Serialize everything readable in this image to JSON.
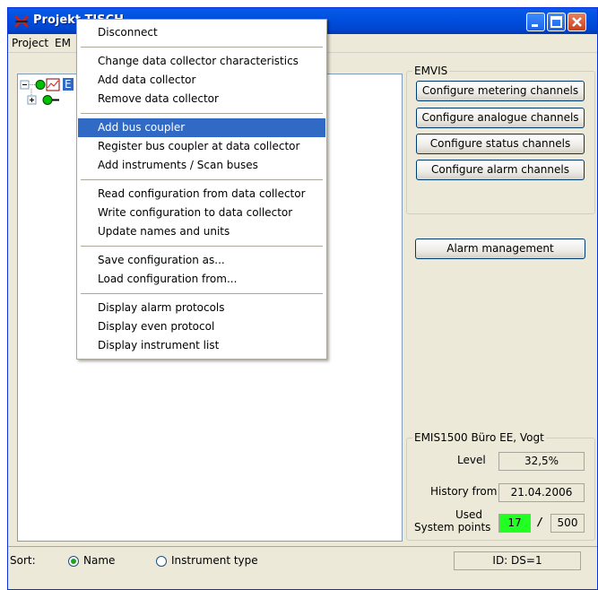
{
  "window": {
    "title": "Projekt TISCH"
  },
  "menubar": [
    "Project",
    "EM"
  ],
  "context_menu": {
    "sections": [
      [
        "Disconnect"
      ],
      [
        "Change data collector characteristics",
        "Add data collector",
        "Remove data collector"
      ],
      [
        "Add bus coupler",
        "Register bus coupler at data collector",
        "Add instruments / Scan buses"
      ],
      [
        "Read configuration from data collector",
        "Write configuration to data collector",
        "Update names and units"
      ],
      [
        "Save configuration as...",
        "Load configuration from..."
      ],
      [
        "Display alarm protocols",
        "Display even protocol",
        "Display instrument list"
      ]
    ],
    "highlighted": "Add bus coupler"
  },
  "tree": {
    "root_label": "E"
  },
  "emvis": {
    "title": "EMVIS",
    "buttons": [
      "Configure metering channels",
      "Configure analogue channels",
      "Configure status channels",
      "Configure alarm channels"
    ]
  },
  "alarm_management_button": "Alarm management",
  "info": {
    "title": "EMIS1500 Büro EE, Vogt",
    "level_label": "Level",
    "level_value": "32,5%",
    "history_label": "History from",
    "history_value": "21.04.2006",
    "used_label_1": "Used",
    "used_label_2": "System points",
    "used_value": "17",
    "separator": "/",
    "total_value": "500",
    "used_color": "#22ff22"
  },
  "statusbar": {
    "sort_label": "Sort:",
    "option_name": "Name",
    "option_type": "Instrument type",
    "selected": "Name",
    "id_text": "ID: DS=1"
  }
}
